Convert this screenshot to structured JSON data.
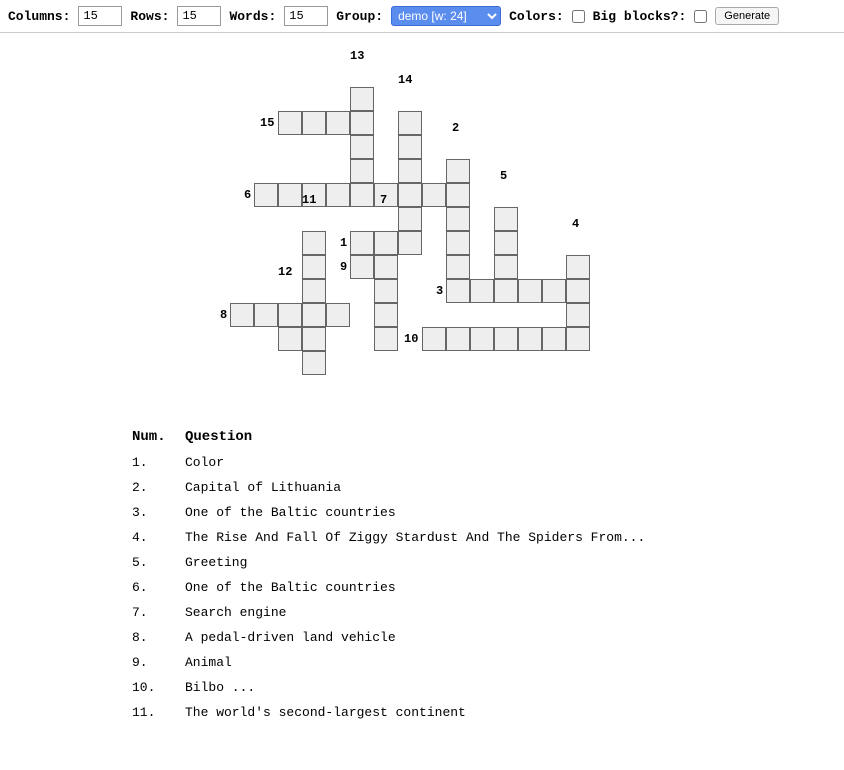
{
  "toolbar": {
    "columns_label": "Columns:",
    "columns_value": "15",
    "rows_label": "Rows:",
    "rows_value": "15",
    "words_label": "Words:",
    "words_value": "15",
    "group_label": "Group:",
    "group_selected": "demo [w: 24]",
    "colors_label": "Colors:",
    "bigblocks_label": "Big blocks?:",
    "generate_label": "Generate"
  },
  "clues_header": {
    "num": "Num.",
    "question": "Question"
  },
  "clues": [
    {
      "n": "1.",
      "q": "Color"
    },
    {
      "n": "2.",
      "q": "Capital of Lithuania"
    },
    {
      "n": "3.",
      "q": "One of the Baltic countries"
    },
    {
      "n": "4.",
      "q": "The Rise And Fall Of Ziggy Stardust And The Spiders From..."
    },
    {
      "n": "5.",
      "q": "Greeting"
    },
    {
      "n": "6.",
      "q": "One of the Baltic countries"
    },
    {
      "n": "7.",
      "q": "Search engine"
    },
    {
      "n": "8.",
      "q": "A pedal-driven land vehicle"
    },
    {
      "n": "9.",
      "q": "Animal"
    },
    {
      "n": "10.",
      "q": "Bilbo ..."
    },
    {
      "n": "11.",
      "q": "The world's second-largest continent"
    }
  ],
  "grid": {
    "cell_size": 24,
    "numbers": [
      {
        "n": "13",
        "col": 5,
        "row": 0
      },
      {
        "n": "14",
        "col": 7,
        "row": 1
      },
      {
        "n": "15",
        "col": 2,
        "row": 2
      },
      {
        "n": "2",
        "col": 9,
        "row": 3
      },
      {
        "n": "6",
        "col": 1,
        "row": 5
      },
      {
        "n": "5",
        "col": 11,
        "row": 5
      },
      {
        "n": "11",
        "col": 3,
        "row": 6
      },
      {
        "n": "7",
        "col": 6,
        "row": 6
      },
      {
        "n": "1",
        "col": 5,
        "row": 7
      },
      {
        "n": "4",
        "col": 14,
        "row": 7
      },
      {
        "n": "9",
        "col": 5,
        "row": 8
      },
      {
        "n": "3",
        "col": 9,
        "row": 9
      },
      {
        "n": "12",
        "col": 2,
        "row": 9
      },
      {
        "n": "8",
        "col": 0,
        "row": 10
      },
      {
        "n": "10",
        "col": 8,
        "row": 11
      }
    ],
    "cells": [
      [
        5,
        1
      ],
      [
        5,
        2
      ],
      [
        7,
        2
      ],
      [
        2,
        2
      ],
      [
        3,
        2
      ],
      [
        4,
        2
      ],
      [
        5,
        3
      ],
      [
        7,
        3
      ],
      [
        5,
        4
      ],
      [
        7,
        4
      ],
      [
        9,
        4
      ],
      [
        1,
        5
      ],
      [
        2,
        5
      ],
      [
        3,
        5
      ],
      [
        4,
        5
      ],
      [
        5,
        5
      ],
      [
        6,
        5
      ],
      [
        7,
        5
      ],
      [
        8,
        5
      ],
      [
        9,
        5
      ],
      [
        7,
        6
      ],
      [
        9,
        6
      ],
      [
        11,
        6
      ],
      [
        3,
        7
      ],
      [
        5,
        7
      ],
      [
        6,
        7
      ],
      [
        7,
        7
      ],
      [
        9,
        7
      ],
      [
        11,
        7
      ],
      [
        3,
        8
      ],
      [
        5,
        8
      ],
      [
        6,
        8
      ],
      [
        9,
        8
      ],
      [
        11,
        8
      ],
      [
        14,
        8
      ],
      [
        3,
        9
      ],
      [
        6,
        9
      ],
      [
        9,
        9
      ],
      [
        10,
        9
      ],
      [
        11,
        9
      ],
      [
        12,
        9
      ],
      [
        13,
        9
      ],
      [
        14,
        9
      ],
      [
        0,
        10
      ],
      [
        1,
        10
      ],
      [
        2,
        10
      ],
      [
        3,
        10
      ],
      [
        4,
        10
      ],
      [
        6,
        10
      ],
      [
        14,
        10
      ],
      [
        2,
        11
      ],
      [
        3,
        11
      ],
      [
        6,
        11
      ],
      [
        8,
        11
      ],
      [
        9,
        11
      ],
      [
        10,
        11
      ],
      [
        11,
        11
      ],
      [
        12,
        11
      ],
      [
        13,
        11
      ],
      [
        14,
        11
      ],
      [
        3,
        12
      ]
    ]
  }
}
